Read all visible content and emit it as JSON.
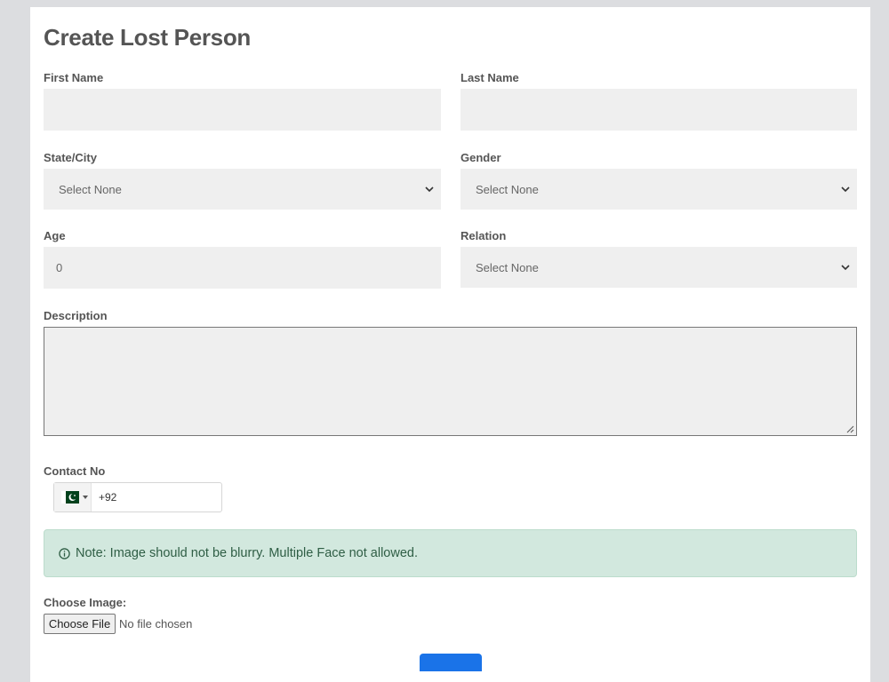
{
  "form": {
    "title": "Create Lost Person",
    "first_name_label": "First Name",
    "first_name_value": "",
    "last_name_label": "Last Name",
    "last_name_value": "",
    "state_label": "State/City",
    "state_value": "Select None",
    "gender_label": "Gender",
    "gender_value": "Select None",
    "age_label": "Age",
    "age_value": "0",
    "relation_label": "Relation",
    "relation_value": "Select None",
    "description_label": "Description",
    "description_value": "",
    "contact_label": "Contact No",
    "contact_value": "+92",
    "contact_country_flag": "pakistan-flag-icon",
    "note_text": "Note: Image should not be blurry. Multiple Face not allowed.",
    "choose_image_label": "Choose Image:",
    "choose_file_button": "Choose File",
    "no_file_text": "No file chosen"
  },
  "colors": {
    "background": "#dcdde0",
    "card": "#ffffff",
    "field": "#efefef",
    "alert_bg": "#d2e8de",
    "alert_text": "#2f5e45",
    "submit": "#1a73e8",
    "flag_green": "#01411c"
  }
}
